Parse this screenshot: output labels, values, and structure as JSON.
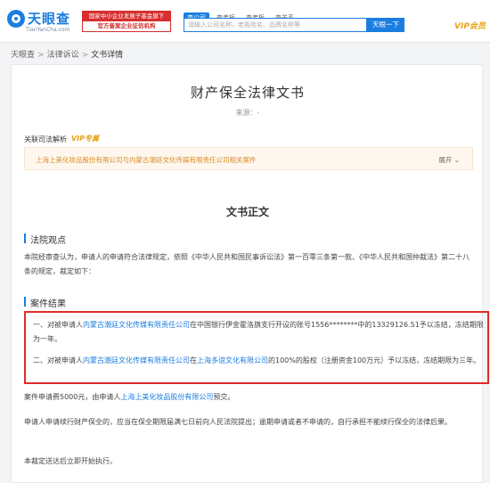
{
  "header": {
    "logo_text": "天眼查",
    "logo_sub": "TianYanCha.com",
    "cert_top": "国家中小企业发展子基金旗下",
    "cert_bottom": "官方备案企业征信机构",
    "search_tabs": [
      "查公司",
      "查老板",
      "查老板",
      "查关系"
    ],
    "search_placeholder": "请输入公司名称、老板姓名、品牌名称等",
    "search_button": "天眼一下",
    "vip_label": "VIP会员"
  },
  "breadcrumb": {
    "items": [
      "天眼查",
      "法律诉讼",
      "文书详情"
    ],
    "sep": ">"
  },
  "document": {
    "title": "财产保全法律文书",
    "source": "来源：-",
    "related_label": "关联司法解析",
    "vip_badge": "VIP专属",
    "related_text": "上海上美化妆品股份有限公司与内蒙古潮廷文化传媒有限责任公司相关案件",
    "expand": "展开",
    "body_title": "文书正文",
    "section_court_view": "法院观点",
    "court_view_text": "本院经审查认为，申请人的申请符合法律规定，依照《中华人民共和国民事诉讼法》第一百零三条第一款、《中华人民共和国仲裁法》第二十八条的规定，裁定如下：",
    "section_result": "案件结果",
    "result_1_prefix": "一、对被申请人",
    "result_1_company": "内蒙古潮廷文化传媒有限责任公司",
    "result_1_suffix": "在中国银行伊金霍洛旗支行开设的账号1556********中的13329126.51予以冻结，冻结期限为一年。",
    "result_2_prefix": "二、对被申请人",
    "result_2_company": "内蒙古潮廷文化传媒有限责任公司",
    "result_2_mid": "在",
    "result_2_company2": "上海多谊文化有限公司",
    "result_2_suffix": "的100%的股权（注册资金100万元）予以冻结，冻结期限为三年。",
    "fee_prefix": "案件申请费5000元，由申请人",
    "fee_company": "上海上美化妆品股份有限公司",
    "fee_suffix": "预交。",
    "apply_text": "申请人申请续行财产保全的，应当在保全期限届满七日前向人民法院提出；逾期申请或者不申请的，自行承担不能续行保全的法律后果。",
    "exec_text": "本裁定送达后立即开始执行。"
  }
}
